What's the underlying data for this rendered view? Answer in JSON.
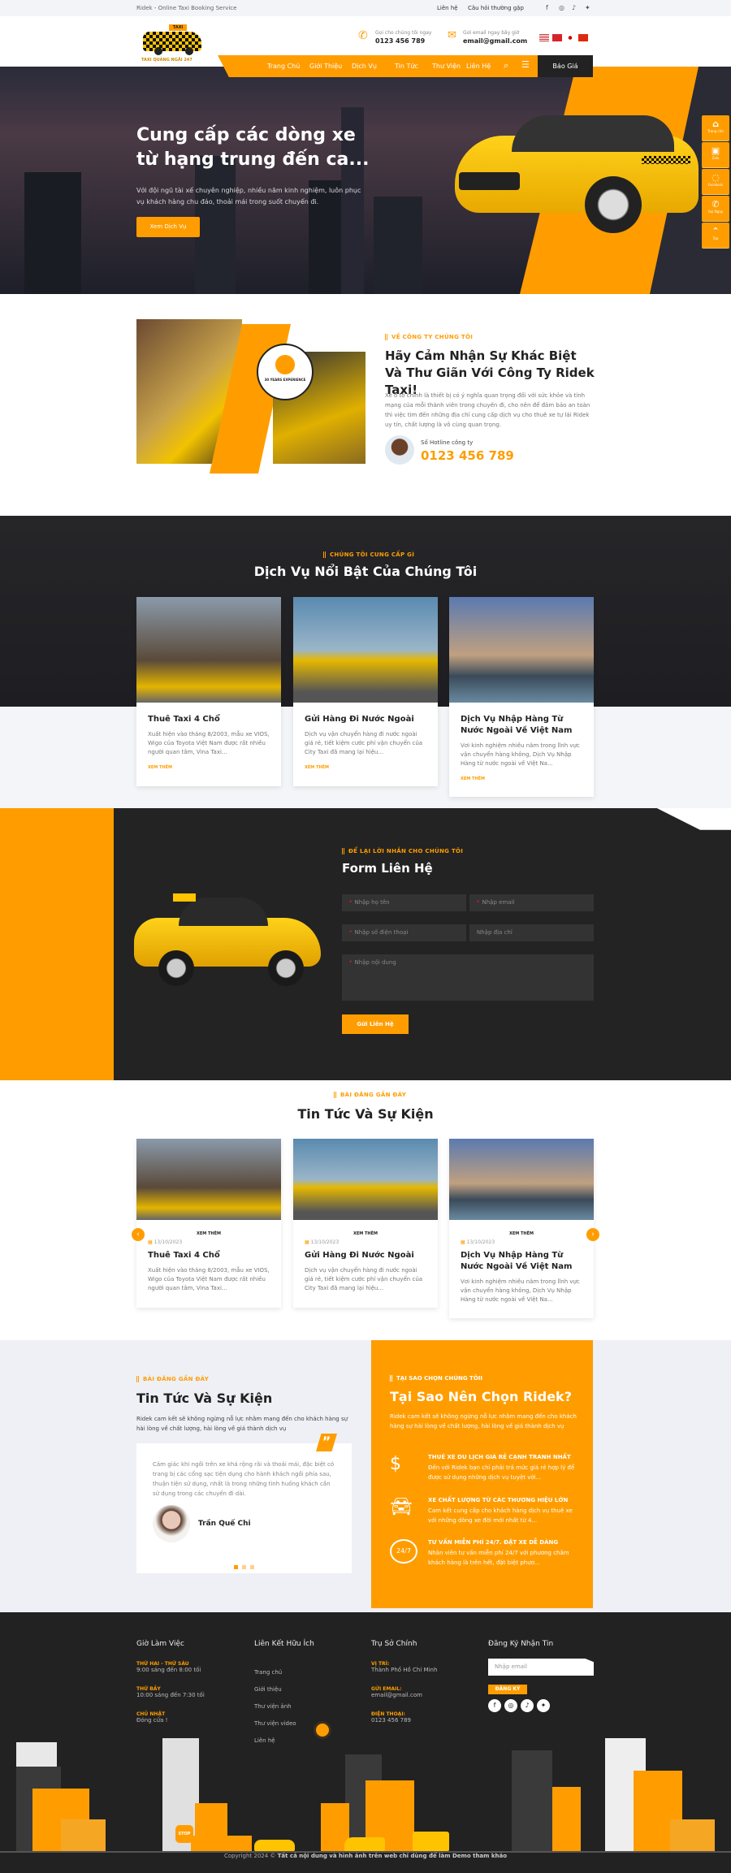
{
  "topbar": {
    "tagline": "Ridek - Online Taxi Booking Service",
    "links": [
      "Liên hệ",
      "Câu hỏi thường gặp"
    ],
    "social": [
      "facebook-icon",
      "instagram-icon",
      "tiktok-icon",
      "twitter-icon"
    ]
  },
  "header": {
    "logo_text": "TAXI QUẢNG NGÃI 247",
    "logo_badge": "TAXI",
    "call_label": "Gọi cho chúng tôi ngay",
    "call_value": "0123 456 789",
    "email_label": "Gửi email ngay bây giờ",
    "email_value": "email@gmail.com",
    "languages": [
      "en",
      "vi",
      "ja",
      "zh"
    ]
  },
  "nav": {
    "items": [
      "Trang Chủ",
      "Giới Thiệu",
      "Dịch Vụ",
      "Tin Tức",
      "Thư Viện",
      "Liên Hệ"
    ],
    "quote": "Báo Giá"
  },
  "hero": {
    "title": "Cung cấp các dòng xe từ hạng trung đến ca...",
    "desc": "Với đội ngũ tài xế chuyên nghiệp, nhiều năm kinh nghiệm, luôn phục vụ khách hàng chu đáo, thoải mái trong suốt chuyến đi.",
    "button": "Xem Dịch Vụ"
  },
  "side_buttons": [
    {
      "icon": "home-icon",
      "label": "Trang chủ"
    },
    {
      "icon": "zalo-icon",
      "label": "Zalo"
    },
    {
      "icon": "messenger-icon",
      "label": "Facebook"
    },
    {
      "icon": "phone-icon",
      "label": "Gọi Ngay"
    },
    {
      "icon": "chevron-up-icon",
      "label": "Top"
    }
  ],
  "about": {
    "tag": "VỀ CÔNG TY CHÚNG TÔI",
    "title": "Hãy Cảm Nhận Sự Khác Biệt Và Thư Giãn Với Công Ty Ridek Taxi!",
    "desc": "Xe ô tô chính là thiết bị có ý nghĩa quan trọng đối với sức khỏe và tính mạng của mỗi thành viên trong chuyến đi, cho nên để đảm bảo an toàn thì việc tìm đến những địa chỉ cung cấp dịch vụ cho thuê xe tự lái Ridek uy tín, chất lượng là vô cùng quan trọng.",
    "badge": "30 YEARS EXPERIENCE",
    "hotline_label": "Số Hotline công ty",
    "hotline": "0123 456 789"
  },
  "services": {
    "tag": "CHÚNG TÔI CUNG CẤP GÌ",
    "title": "Dịch Vụ Nổi Bật Của Chúng Tôi",
    "more": "XEM THÊM",
    "items": [
      {
        "title": "Thuê Taxi 4 Chổ",
        "desc": "Xuất hiện vào tháng 8/2003, mẫu xe VIOS, Wigo của Toyota Việt Nam được rất nhiều người quan tâm, Vina Taxi..."
      },
      {
        "title": "Gửi Hàng Đi Nước Ngoài",
        "desc": "Dịch vụ vận chuyển hàng đi nước ngoài giá rẻ, tiết kiệm cước phí vận chuyển của City Taxi đã mang lại hiệu..."
      },
      {
        "title": "Dịch Vụ Nhập Hàng Từ Nước Ngoài Về Việt Nam",
        "desc": "Vơi kinh nghiệm nhiều năm trong lĩnh vực vận chuyển hàng không, Dịch Vụ Nhập Hàng từ nước ngoài về Việt Na..."
      }
    ]
  },
  "contact": {
    "tag": "ĐỂ LẠI LỜI NHẮN CHO CHÚNG TÔI",
    "title": "Form Liên Hệ",
    "name_ph": "Nhập họ tên",
    "email_ph": "Nhập email",
    "phone_ph": "Nhập số điện thoại",
    "address_ph": "Nhập địa chỉ",
    "message_ph": "Nhập nội dung",
    "submit": "Gửi Liên Hệ"
  },
  "news": {
    "tag": "BÀI ĐĂNG GẦN ĐÂY",
    "title": "Tin Tức Và Sự Kiện",
    "more": "XEM THÊM",
    "items": [
      {
        "date": "13/10/2023",
        "title": "Thuê Taxi 4 Chổ",
        "desc": "Xuất hiện vào tháng 8/2003, mẫu xe VIOS, Wigo của Toyota Việt Nam được rất nhiều người quan tâm, Vina Taxi..."
      },
      {
        "date": "13/10/2023",
        "title": "Gửi Hàng Đi Nước Ngoài",
        "desc": "Dịch vụ vận chuyển hàng đi nước ngoài giá rẻ, tiết kiệm cước phí vận chuyển của City Taxi đã mang lại hiệu..."
      },
      {
        "date": "13/10/2023",
        "title": "Dịch Vụ Nhập Hàng Từ Nước Ngoài Về Việt Nam",
        "desc": "Vơi kinh nghiệm nhiều năm trong lĩnh vực vận chuyển hàng không, Dịch Vụ Nhập Hàng từ nước ngoài về Việt Na..."
      }
    ]
  },
  "testimonials": {
    "tag": "BÀI ĐĂNG GẦN ĐÂY",
    "title": "Tin Tức Và Sự Kiện",
    "desc": "Ridek cam kết sẽ không ngừng nỗ lực nhằm mang đến cho khách hàng sự hài lòng về chất lượng, hài lòng về giá thành dịch vụ",
    "quote": "Cảm giác khi ngồi trên xe khá rộng rãi và thoải mái, đặc biệt có trang bị các cổng sạc tiện dụng cho hành khách ngồi phía sau, thuận tiện sử dụng, nhất là trong những tình huống khách cần sử dụng trong các chuyến đi dài.",
    "author": "Trần Quế Chi",
    "slides": 3,
    "active_slide": 1
  },
  "why": {
    "tag": "TẠI SAO CHỌN CHÚNG TÔII",
    "title": "Tại Sao Nên Chọn Ridek?",
    "desc": "Ridek cam kết sẽ không ngừng nỗ lực nhằm mang đến cho khách hàng sự hài lòng về chất lượng, hài lòng về giá thành dịch vụ",
    "items": [
      {
        "icon": "money-hand-icon",
        "title": "THUÊ XE DU LỊCH GIÁ RẺ CẠNH TRANH NHẤT",
        "desc": "Đến với Ridek bạn chỉ phải trả mức giá rẻ hợp lý để được sử dụng những dịch vụ tuyệt vời..."
      },
      {
        "icon": "car-icon",
        "title": "XE CHẤT LƯỢNG TỪ CÁC THƯƠNG HIỆU LỚN",
        "desc": "Cam kết cung cấp cho khách hàng dịch vụ thuê xe với những dòng xe đời mới nhất từ 4..."
      },
      {
        "icon": "support-24-7-icon",
        "title": "TƯ VẤN MIỄN PHÍ 24/7. ĐẶT XE DỄ DÀNG",
        "desc": "Nhân viên tư vấn miễn phí 24/7 với phương châm khách hàng là trên hết, đặt biệt phươ..."
      }
    ]
  },
  "footer": {
    "hours_title": "Giờ Làm Việc",
    "hours": [
      {
        "label": "THỨ HAI -  THỨ SÁU",
        "value": "9:00 sáng đến 8:00 tối"
      },
      {
        "label": "THỨ BẢY",
        "value": "10:00 sáng đến 7:30 tối"
      },
      {
        "label": "CHỦ NHẬT",
        "value": "Đóng cửa !"
      }
    ],
    "links_title": "Liên Kết Hữu Ích",
    "links": [
      "Trang chủ",
      "Giới thiệu",
      "Thư viện ảnh",
      "Thư viện video",
      "Liên hệ"
    ],
    "office_title": "Trụ Sở Chính",
    "office": [
      {
        "label": "VỊ TRÍ:",
        "value": "Thành Phố Hồ Chí Minh"
      },
      {
        "label": "GỬI EMAIL:",
        "value": "email@gmail.com"
      },
      {
        "label": "ĐIỆN THOẠI:",
        "value": "0123 456 789"
      }
    ],
    "newsletter_title": "Đăng Ký Nhận Tin",
    "newsletter_ph": "Nhập email",
    "subscribe": "ĐĂNG KÝ",
    "stop_sign": "STOP",
    "copyright_pre": "Copyright 2024 © ",
    "copyright": "Tất cả nội dung và hình ảnh trên web chỉ dùng để làm Demo tham khảo"
  },
  "colors": {
    "accent": "#ff9d00",
    "dark": "#222222"
  }
}
